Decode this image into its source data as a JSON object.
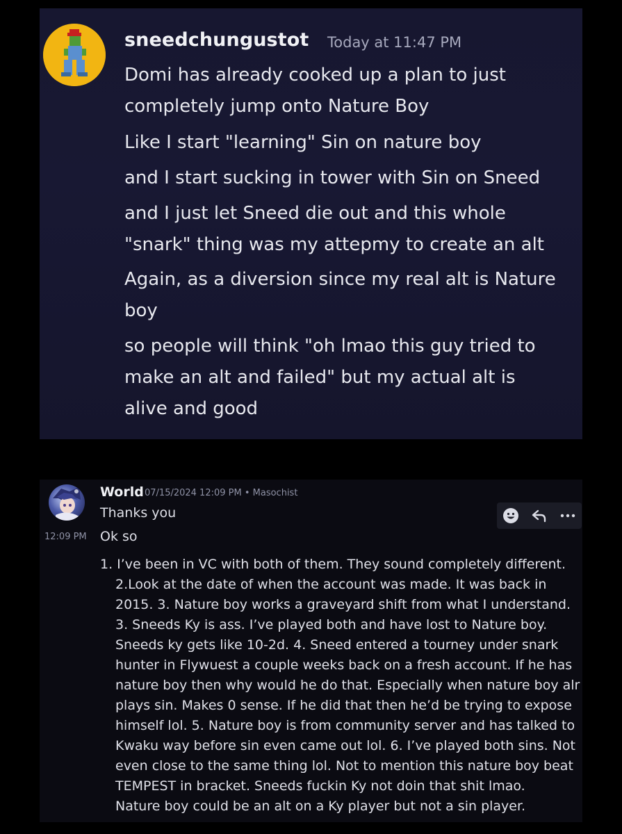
{
  "message1": {
    "username": "sneedchungustot",
    "timestamp": "Today at 11:47 PM",
    "avatar_icon": "frog-avatar-icon",
    "lines": [
      "Domi has already cooked up a plan to just",
      "completely jump onto Nature Boy",
      "Like I start \"learning\" Sin on nature boy",
      "and I start sucking in tower with Sin on Sneed",
      "and I just let Sneed die out and this whole",
      "\"snark\" thing was my attepmy to create an alt",
      "Again, as a diversion since my real alt is Nature",
      "boy",
      "so people will think \"oh lmao this guy tried to",
      "make an alt and failed\" but my actual alt is",
      "alive and good"
    ]
  },
  "message2": {
    "username": "World",
    "meta": "07/15/2024 12:09 PM • Masochist",
    "avatar_icon": "anime-avatar-icon",
    "line1": "Thanks you",
    "stamp": "12:09 PM",
    "line2": "Ok so",
    "toolbar": {
      "react_icon": "emoji-icon",
      "reply_icon": "reply-icon",
      "more_icon": "more-icon"
    },
    "list_lines": [
      "1. I’ve been in VC with both of them. They sound completely different.",
      "2.Look at the date of when the account was made. It was back in",
      "2015. 3. Nature boy works a graveyard shift from what I understand.",
      "3. Sneeds Ky is ass. I’ve played both and have lost to Nature boy.",
      "Sneeds ky gets like 10-2d. 4. Sneed entered a tourney under snark",
      "hunter in Flywuest a couple weeks back on a fresh account. If he has",
      "nature boy then why would he do that. Especially when nature boy alr",
      "plays sin. Makes 0 sense. If he did that then he’d be trying to expose",
      "himself lol. 5. Nature boy is from community server and has talked to",
      "Kwaku way before sin even came out lol. 6. I’ve played both sins. Not",
      "even close to the same thing lol.  Not to mention this nature boy beat",
      "TEMPEST in bracket. Sneeds fuckin Ky not doin that shit lmao.",
      "Nature boy could be an alt on a Ky player but not a sin player."
    ]
  },
  "colors": {
    "card1_bg": "#181833",
    "card2_bg": "#0b0b12",
    "avatar1_bg": "#f2b512",
    "muted_text": "#8f92a6"
  }
}
